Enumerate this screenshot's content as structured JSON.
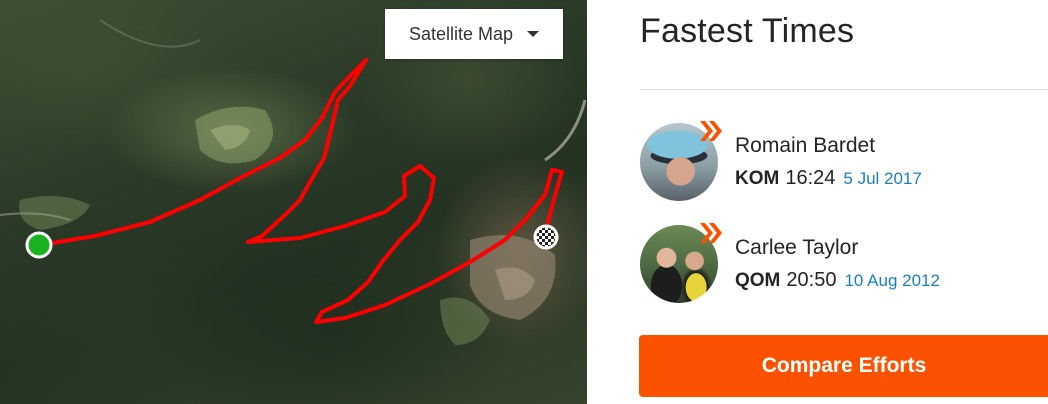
{
  "map": {
    "type_label": "Satellite Map",
    "icons": {
      "start": "start-marker-icon",
      "finish": "finish-flag-icon",
      "dropdown": "caret-down-icon"
    },
    "route_color": "#ff0000",
    "start_color": "#18b31f"
  },
  "panel": {
    "title": "Fastest Times",
    "leaders": [
      {
        "name": "Romain Bardet",
        "badge": "KOM",
        "time": "16:24",
        "date": "5 Jul 2017"
      },
      {
        "name": "Carlee Taylor",
        "badge": "QOM",
        "time": "20:50",
        "date": "10 Aug 2012"
      }
    ],
    "compare_label": "Compare Efforts"
  },
  "colors": {
    "accent": "#fc5200",
    "link": "#1a7fbf",
    "text": "#242428"
  }
}
